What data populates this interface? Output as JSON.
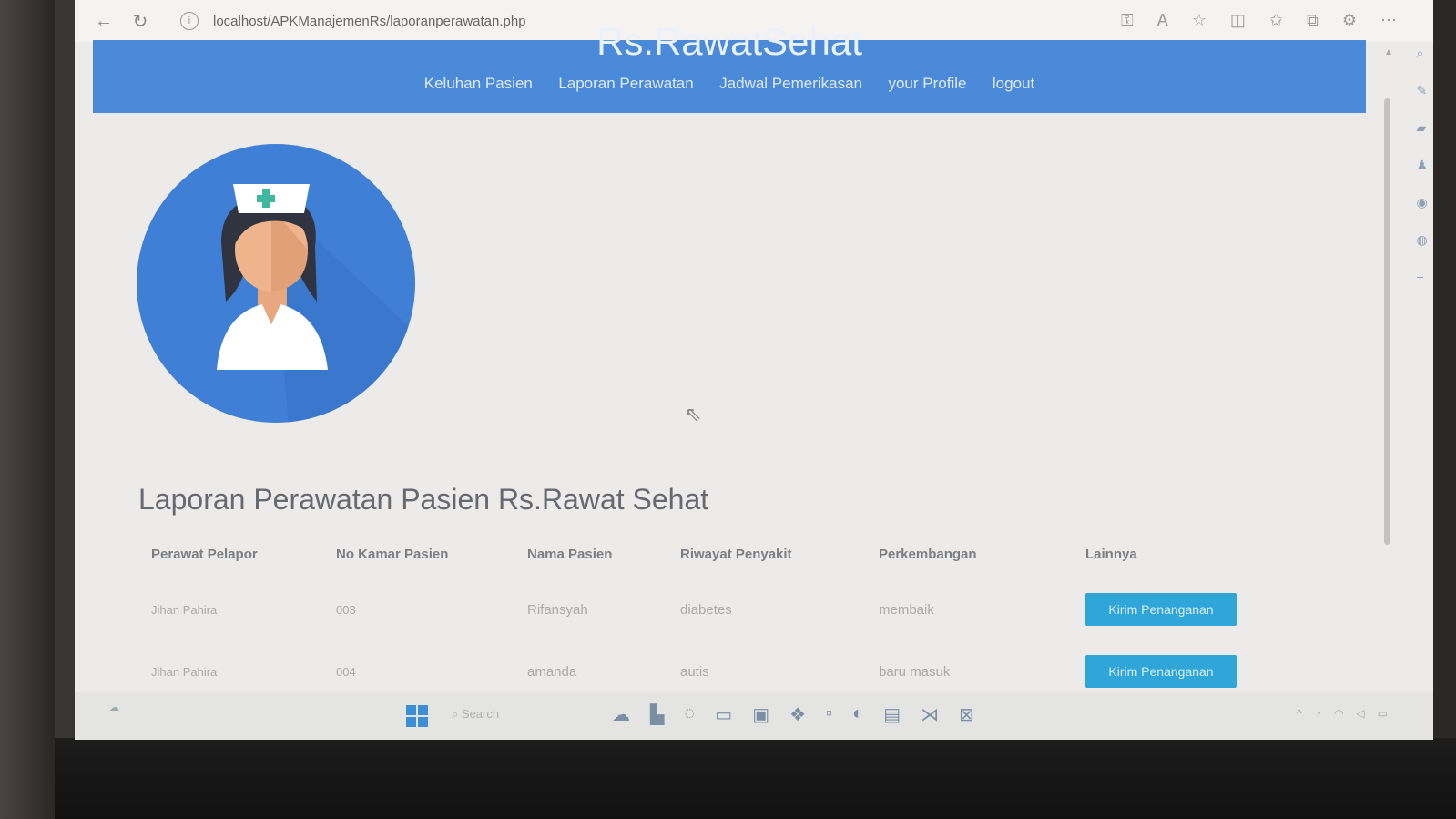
{
  "browser": {
    "url": "localhost/APKManajemenRs/laporanperawatan.php"
  },
  "site": {
    "brand": "Rs.RawatSehat",
    "nav": [
      "Keluhan Pasien",
      "Laporan Perawatan",
      "Jadwal Pemerikasan",
      "your Profile",
      "logout"
    ]
  },
  "main": {
    "title": "Laporan Perawatan Pasien Rs.Rawat Sehat",
    "table": {
      "headers": [
        "Perawat Pelapor",
        "No Kamar Pasien",
        "Nama Pasien",
        "Riwayat Penyakit",
        "Perkembangan",
        "Lainnya"
      ],
      "rows": [
        {
          "perawat": "Jihan Pahira",
          "kamar": "003",
          "nama": "Rifansyah",
          "riwayat": "diabetes",
          "perkembangan": "membaik",
          "action": "Kirim Penanganan"
        },
        {
          "perawat": "Jihan Pahira",
          "kamar": "004",
          "nama": "amanda",
          "riwayat": "autis",
          "perkembangan": "baru masuk",
          "action": "Kirim Penanganan"
        }
      ]
    }
  },
  "taskbar": {
    "search_placeholder": "Search"
  },
  "colors": {
    "header_blue": "#4a8ad8",
    "button_blue": "#2fa5d8",
    "avatar_circle": "#3f7fd6"
  }
}
